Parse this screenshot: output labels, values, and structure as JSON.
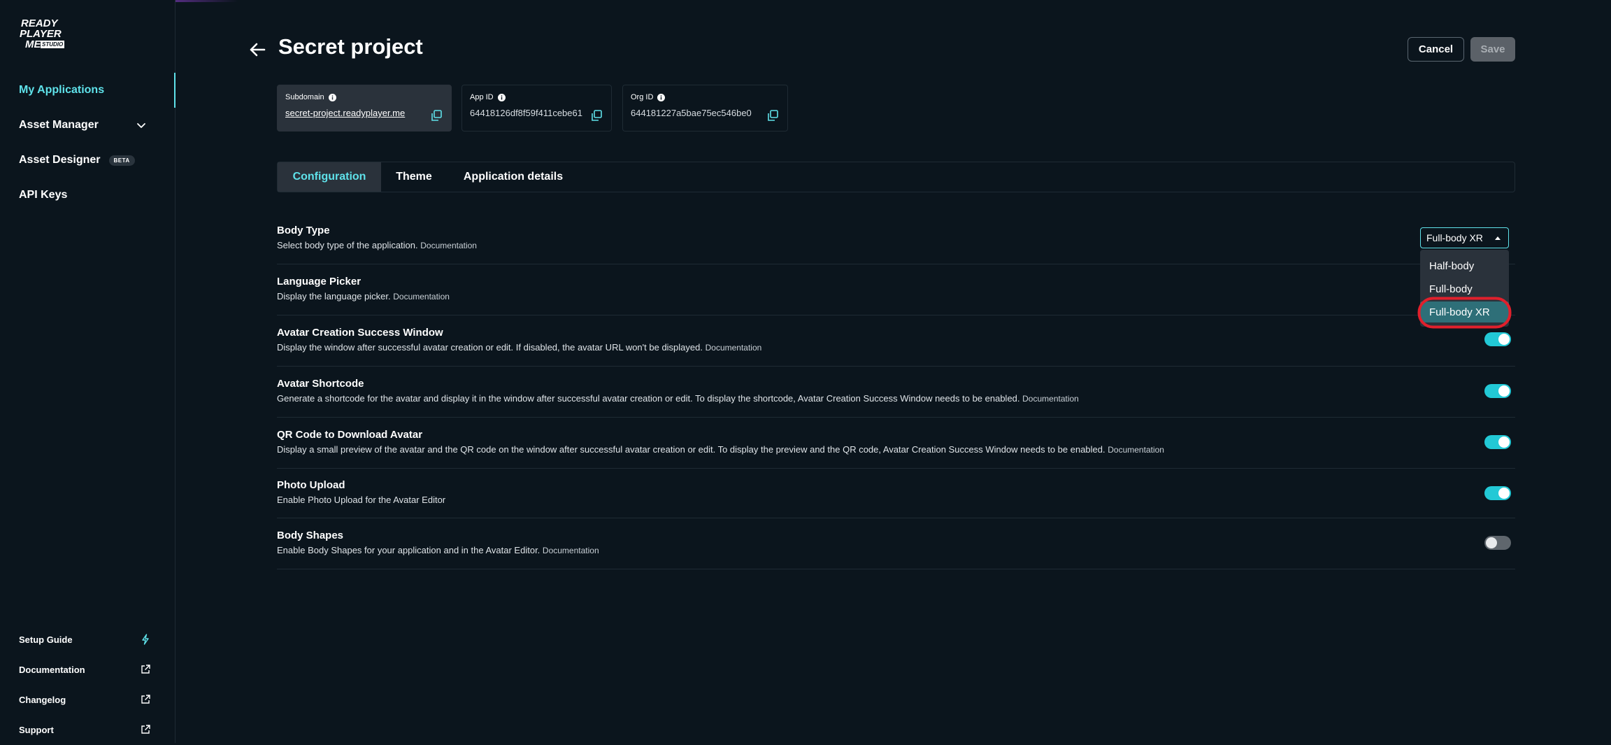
{
  "sidebar": {
    "logo": {
      "line1": "READY",
      "line2": "PLAYER",
      "line3": "ME",
      "badge": "STUDIO"
    },
    "items": [
      {
        "label": "My Applications",
        "active": true
      },
      {
        "label": "Asset Manager",
        "icon": "chevron-down-icon"
      },
      {
        "label": "Asset Designer",
        "badge": "BETA"
      },
      {
        "label": "API Keys"
      }
    ],
    "bottom_items": [
      {
        "label": "Setup Guide",
        "icon": "lightning-icon"
      },
      {
        "label": "Documentation",
        "icon": "external-link-icon"
      },
      {
        "label": "Changelog",
        "icon": "external-link-icon"
      },
      {
        "label": "Support",
        "icon": "external-link-icon"
      }
    ]
  },
  "header": {
    "title": "Secret project",
    "cancel_label": "Cancel",
    "save_label": "Save"
  },
  "ids": {
    "subdomain": {
      "label": "Subdomain",
      "value": "secret-project.readyplayer.me"
    },
    "app_id": {
      "label": "App ID",
      "value": "64418126df8f59f411cebe61"
    },
    "org_id": {
      "label": "Org ID",
      "value": "644181227a5bae75ec546be0"
    }
  },
  "tabs": [
    {
      "label": "Configuration",
      "active": true
    },
    {
      "label": "Theme"
    },
    {
      "label": "Application details"
    }
  ],
  "settings": [
    {
      "name": "Body Type",
      "desc": "Select body type of the application.",
      "doc": "Documentation"
    },
    {
      "name": "Language Picker",
      "desc": "Display the language picker.",
      "doc": "Documentation"
    },
    {
      "name": "Avatar Creation Success Window",
      "desc": "Display the window after successful avatar creation or edit. If disabled, the avatar URL won't be displayed.",
      "doc": "Documentation",
      "toggle": "on"
    },
    {
      "name": "Avatar Shortcode",
      "desc": "Generate a shortcode for the avatar and display it in the window after successful avatar creation or edit. To display the shortcode, Avatar Creation Success Window needs to be enabled.",
      "doc": "Documentation",
      "toggle": "on"
    },
    {
      "name": "QR Code to Download Avatar",
      "desc": "Display a small preview of the avatar and the QR code on the window after successful avatar creation or edit. To display the preview and the QR code, Avatar Creation Success Window needs to be enabled.",
      "doc": "Documentation",
      "toggle": "on"
    },
    {
      "name": "Photo Upload",
      "desc": "Enable Photo Upload for the Avatar Editor",
      "doc": "",
      "toggle": "on"
    },
    {
      "name": "Body Shapes",
      "desc": "Enable Body Shapes for your application and in the Avatar Editor.",
      "doc": "Documentation",
      "toggle": "off"
    }
  ],
  "body_type_select": {
    "selected": "Full-body XR",
    "options": [
      "Half-body",
      "Full-body",
      "Full-body XR"
    ]
  },
  "colors": {
    "accent": "#5fe2ea",
    "toggle_on": "#22c9d6",
    "highlight_ring": "#e0202c",
    "background": "#0b151d"
  }
}
